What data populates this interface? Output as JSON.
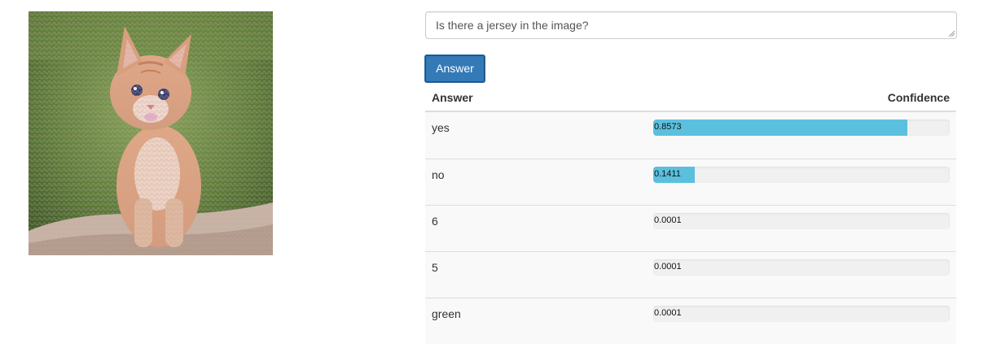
{
  "question": {
    "value": "Is there a jersey in the image?"
  },
  "answer_button": {
    "label": "Answer",
    "color": "#337ab7"
  },
  "table": {
    "headers": {
      "answer": "Answer",
      "confidence": "Confidence"
    },
    "rows": [
      {
        "answer": "yes",
        "confidence": 0.8573,
        "confidence_text": "0.8573"
      },
      {
        "answer": "no",
        "confidence": 0.1411,
        "confidence_text": "0.1411"
      },
      {
        "answer": "6",
        "confidence": 0.0001,
        "confidence_text": "0.0001"
      },
      {
        "answer": "5",
        "confidence": 0.0001,
        "confidence_text": "0.0001"
      },
      {
        "answer": "green",
        "confidence": 0.0001,
        "confidence_text": "0.0001"
      }
    ],
    "bar_color": "#5bc0de"
  }
}
